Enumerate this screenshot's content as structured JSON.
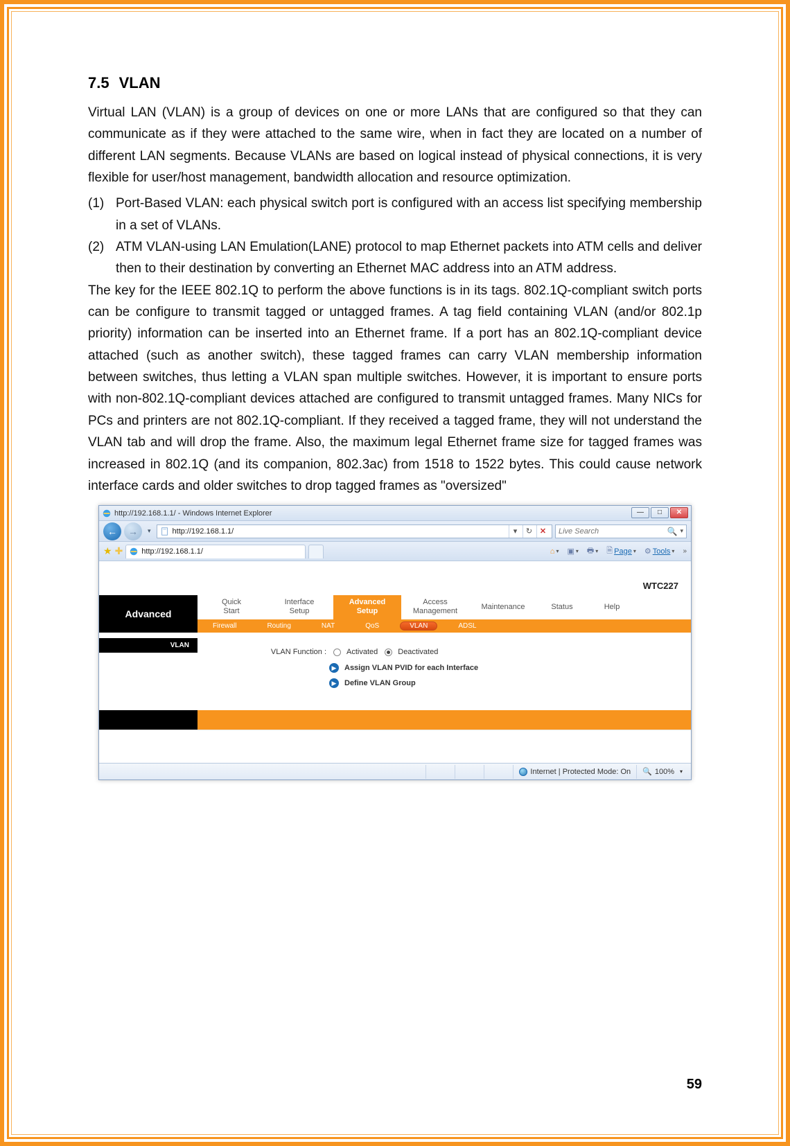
{
  "page_number": "59",
  "heading_number": "7.5",
  "heading_title": "VLAN",
  "para1": "Virtual LAN (VLAN) is a group of devices on one or more LANs that are configured so that they can communicate as if they were attached to the same wire, when in fact they are located on a number of different LAN segments. Because VLANs are based on logical instead of physical connections, it is very flexible for user/host management, bandwidth allocation and resource optimization.",
  "list1_marker": "(1)",
  "list1_text": "Port-Based VLAN: each physical switch port is configured with an access list specifying membership in a set of VLANs.",
  "list2_marker": "(2)",
  "list2_text": "ATM VLAN-using LAN Emulation(LANE) protocol to map Ethernet packets into ATM cells and deliver then to their destination by converting an Ethernet MAC address into an ATM address.",
  "para2": "The key for the IEEE 802.1Q to perform the above functions is in its tags. 802.1Q-compliant switch ports can be configure to transmit tagged or untagged frames. A tag field containing VLAN (and/or 802.1p priority) information can be inserted into an Ethernet frame. If a port has an 802.1Q-compliant device attached (such as another switch), these tagged frames can carry VLAN membership information between switches, thus letting a VLAN span multiple switches. However, it is important to ensure ports with non-802.1Q-compliant devices attached are configured to transmit untagged frames. Many NICs for PCs and printers are not 802.1Q-compliant. If they received a tagged frame, they will not understand the VLAN tab and will drop the frame. Also, the maximum legal Ethernet frame size for tagged frames was increased in 802.1Q (and its companion, 802.3ac) from 1518 to 1522 bytes. This could cause network interface cards and older switches to drop tagged frames as \"oversized\"",
  "browser": {
    "window_title": "http://192.168.1.1/ - Windows Internet Explorer",
    "address_url": "http://192.168.1.1/",
    "tab_title": "http://192.168.1.1/",
    "search_placeholder": "Live Search",
    "page_menu_label": "Page",
    "tools_menu_label": "Tools",
    "status_text": "Internet | Protected Mode: On",
    "zoom_text": "100%"
  },
  "router": {
    "model": "WTC227",
    "nav_heading": "Advanced",
    "tabs": {
      "quick_start": "Quick\nStart",
      "interface_setup": "Interface\nSetup",
      "advanced_setup": "Advanced\nSetup",
      "access_management": "Access\nManagement",
      "maintenance": "Maintenance",
      "status": "Status",
      "help": "Help"
    },
    "subtabs": {
      "firewall": "Firewall",
      "routing": "Routing",
      "nat": "NAT",
      "qos": "QoS",
      "vlan": "VLAN",
      "adsl": "ADSL"
    },
    "section_label": "VLAN",
    "form": {
      "vlan_function_label": "VLAN Function :",
      "activated": "Activated",
      "deactivated": "Deactivated",
      "link1": "Assign VLAN PVID for each Interface",
      "link2": "Define VLAN Group"
    }
  }
}
